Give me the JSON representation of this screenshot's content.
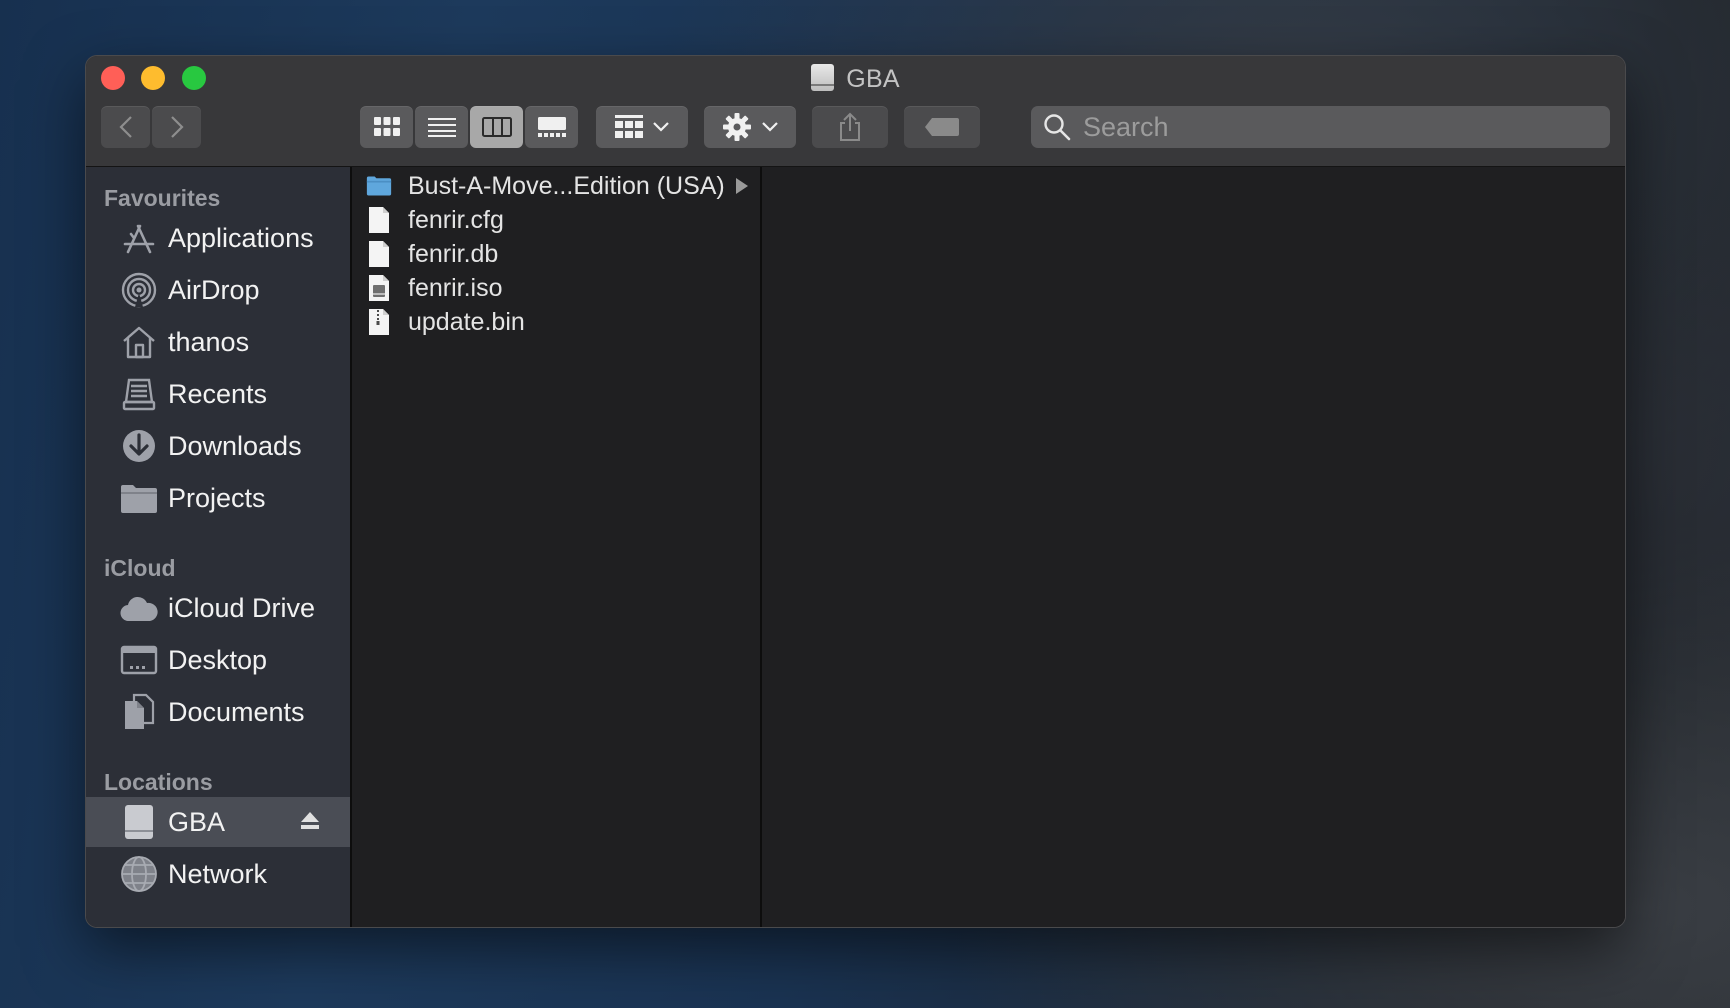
{
  "window": {
    "title": "GBA"
  },
  "toolbar": {
    "back_icon": "chevron-left-icon",
    "forward_icon": "chevron-right-icon",
    "views": [
      "icon-view",
      "list-view",
      "column-view",
      "gallery-view"
    ],
    "active_view": "column-view",
    "group_icon": "group-grid-icon",
    "action_icon": "gear-icon",
    "share_icon": "share-icon",
    "tag_icon": "tag-icon"
  },
  "search": {
    "placeholder": "Search",
    "value": ""
  },
  "sidebar": {
    "favourites_title": "Favourites",
    "favourites": [
      {
        "label": "Applications",
        "icon": "applications-icon"
      },
      {
        "label": "AirDrop",
        "icon": "airdrop-icon"
      },
      {
        "label": "thanos",
        "icon": "home-icon"
      },
      {
        "label": "Recents",
        "icon": "recents-icon"
      },
      {
        "label": "Downloads",
        "icon": "downloads-icon"
      },
      {
        "label": "Projects",
        "icon": "folder-icon"
      }
    ],
    "icloud_title": "iCloud",
    "icloud": [
      {
        "label": "iCloud Drive",
        "icon": "cloud-icon"
      },
      {
        "label": "Desktop",
        "icon": "desktop-icon"
      },
      {
        "label": "Documents",
        "icon": "documents-icon"
      }
    ],
    "locations_title": "Locations",
    "locations": [
      {
        "label": "GBA",
        "icon": "drive-icon",
        "selected": true,
        "eject": true
      },
      {
        "label": "Network",
        "icon": "network-icon"
      }
    ]
  },
  "files": [
    {
      "name": "Bust-A-Move...Edition (USA)",
      "type": "folder",
      "icon": "folder-icon"
    },
    {
      "name": "fenrir.cfg",
      "type": "file",
      "icon": "document-icon"
    },
    {
      "name": "fenrir.db",
      "type": "file",
      "icon": "document-icon"
    },
    {
      "name": "fenrir.iso",
      "type": "file",
      "icon": "disk-image-icon"
    },
    {
      "name": "update.bin",
      "type": "file",
      "icon": "archive-icon"
    }
  ],
  "colors": {
    "close": "#ff5f57",
    "minimize": "#febc2e",
    "maximize": "#28c840",
    "sidebar_bg": "#2c2f37",
    "content_bg": "#1f1f21",
    "folder_blue": "#5fa7dd"
  }
}
